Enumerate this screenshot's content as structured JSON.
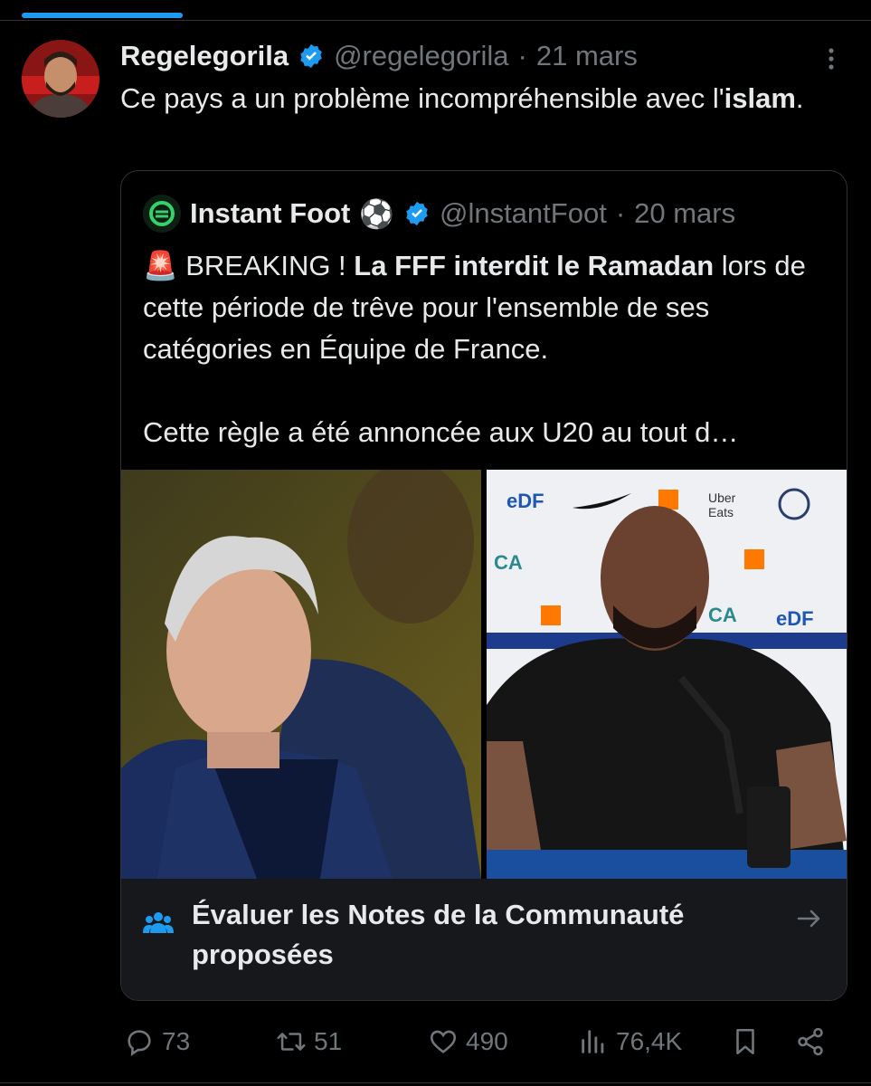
{
  "author": {
    "display_name": "Regelegorila",
    "handle": "@regelegorila",
    "separator": "·",
    "date": "21 mars",
    "verified_color": "#1d9bf0"
  },
  "tweet": {
    "text_part1": "Ce pays a un problème incompréhensible avec l'",
    "text_bold": "islam",
    "text_part2": "."
  },
  "quote": {
    "display_name": "Instant Foot",
    "name_emoji": "⚽",
    "handle": "@lnstantFoot",
    "separator": "·",
    "date": "20 mars",
    "siren": "🚨",
    "text_lead": "BREAKING ! ",
    "text_bold": "La FFF interdit le Ramadan",
    "text_rest": " lors de cette période de trêve pour l'ensemble de ses catégories en Équipe de France.",
    "text_para2": "Cette règle a été annoncée aux U20 au tout d…"
  },
  "community_notes": {
    "label": "Évaluer les Notes de la Communauté proposées",
    "icon": "people-icon"
  },
  "actions": {
    "replies": "73",
    "reposts": "51",
    "likes": "490",
    "views": "76,4K"
  },
  "colors": {
    "accent": "#1d9bf0",
    "muted": "#71767b",
    "background": "#000000"
  }
}
